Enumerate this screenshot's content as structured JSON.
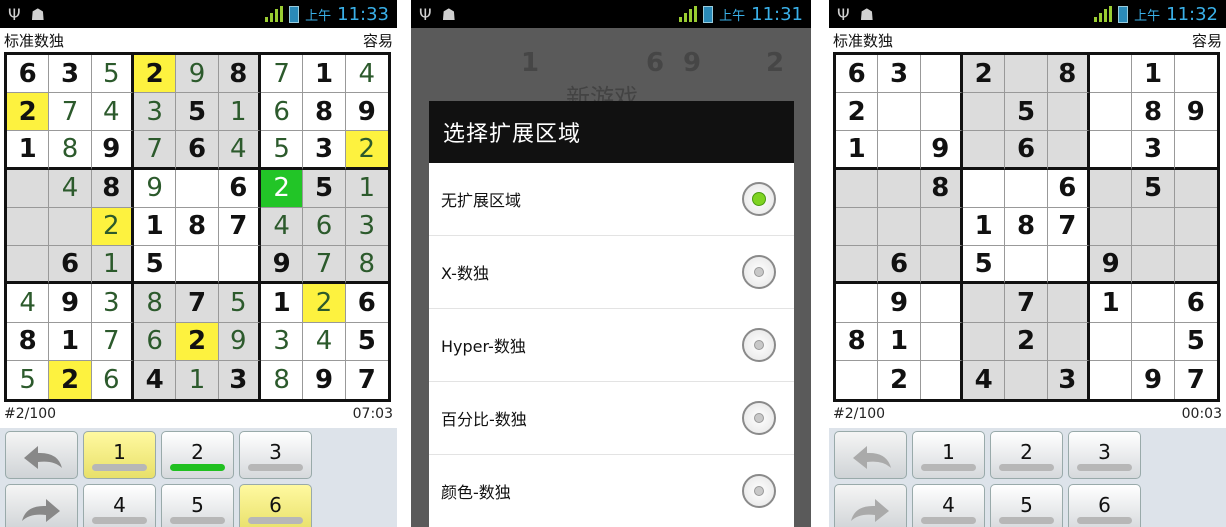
{
  "status": {
    "ampm": "上午",
    "times": [
      "11:33",
      "11:31",
      "11:32"
    ]
  },
  "game": {
    "title": "标准数独",
    "difficulty": "容易"
  },
  "board1": {
    "values": [
      [
        "6",
        "3",
        "5",
        "2",
        "9",
        "8",
        "7",
        "1",
        "4"
      ],
      [
        "2",
        "7",
        "4",
        "3",
        "5",
        "1",
        "6",
        "8",
        "9"
      ],
      [
        "1",
        "8",
        "9",
        "7",
        "6",
        "4",
        "5",
        "3",
        "2"
      ],
      [
        "",
        "4",
        "8",
        "9",
        "",
        "6",
        "2",
        "5",
        "1"
      ],
      [
        "",
        "",
        "2",
        "1",
        "8",
        "7",
        "4",
        "6",
        "3"
      ],
      [
        "",
        "6",
        "1",
        "5",
        "",
        "",
        "9",
        "7",
        "8"
      ],
      [
        "4",
        "9",
        "3",
        "8",
        "7",
        "5",
        "1",
        "2",
        "6"
      ],
      [
        "8",
        "1",
        "7",
        "6",
        "2",
        "9",
        "3",
        "4",
        "5"
      ],
      [
        "5",
        "2",
        "6",
        "4",
        "1",
        "3",
        "8",
        "9",
        "7"
      ]
    ],
    "given": [
      [
        1,
        1,
        0,
        1,
        0,
        1,
        0,
        1,
        0
      ],
      [
        1,
        0,
        0,
        0,
        1,
        0,
        0,
        1,
        1
      ],
      [
        1,
        0,
        1,
        0,
        1,
        0,
        0,
        1,
        0
      ],
      [
        0,
        0,
        1,
        0,
        0,
        1,
        0,
        1,
        0
      ],
      [
        0,
        0,
        0,
        1,
        1,
        1,
        0,
        0,
        0
      ],
      [
        0,
        1,
        0,
        1,
        0,
        0,
        1,
        0,
        0
      ],
      [
        0,
        1,
        0,
        0,
        1,
        0,
        1,
        0,
        1
      ],
      [
        1,
        1,
        0,
        0,
        1,
        0,
        0,
        0,
        1
      ],
      [
        0,
        1,
        0,
        1,
        0,
        1,
        0,
        1,
        1
      ]
    ],
    "highlights": {
      "yellow": [
        [
          0,
          3
        ],
        [
          1,
          0
        ],
        [
          2,
          8
        ],
        [
          4,
          2
        ],
        [
          6,
          7
        ],
        [
          7,
          4
        ],
        [
          8,
          1
        ]
      ],
      "green": [
        [
          3,
          6
        ]
      ]
    },
    "puzzle_number": "#2/100",
    "timer": "07:03"
  },
  "board3": {
    "values": [
      [
        "6",
        "3",
        "",
        "2",
        "",
        "8",
        "",
        "1",
        ""
      ],
      [
        "2",
        "",
        "",
        "",
        "5",
        "",
        "",
        "8",
        "9"
      ],
      [
        "1",
        "",
        "9",
        "",
        "6",
        "",
        "",
        "3",
        ""
      ],
      [
        "",
        "",
        "8",
        "",
        "",
        "6",
        "",
        "5",
        ""
      ],
      [
        "",
        "",
        "",
        "1",
        "8",
        "7",
        "",
        "",
        ""
      ],
      [
        "",
        "6",
        "",
        "5",
        "",
        "",
        "9",
        "",
        ""
      ],
      [
        "",
        "9",
        "",
        "",
        "7",
        "",
        "1",
        "",
        "6"
      ],
      [
        "8",
        "1",
        "",
        "",
        "2",
        "",
        "",
        "",
        "5"
      ],
      [
        "",
        "2",
        "",
        "4",
        "",
        "3",
        "",
        "9",
        "7"
      ]
    ],
    "puzzle_number": "#2/100",
    "timer": "00:03"
  },
  "keypad": {
    "keys": [
      "1",
      "2",
      "3",
      "4",
      "5",
      "6"
    ]
  },
  "dialog": {
    "background_title": "新游戏",
    "background_numbers": [
      "1",
      "6",
      "9",
      "2"
    ],
    "title": "选择扩展区域",
    "options": [
      {
        "label": "无扩展区域",
        "selected": true
      },
      {
        "label": "X-数独",
        "selected": false
      },
      {
        "label": "Hyper-数独",
        "selected": false
      },
      {
        "label": "百分比-数独",
        "selected": false
      },
      {
        "label": "颜色-数独",
        "selected": false
      }
    ]
  },
  "colors": {
    "highlight_yellow": "#fdf23f",
    "highlight_green": "#22c527",
    "status_time": "#3ab0e8"
  }
}
